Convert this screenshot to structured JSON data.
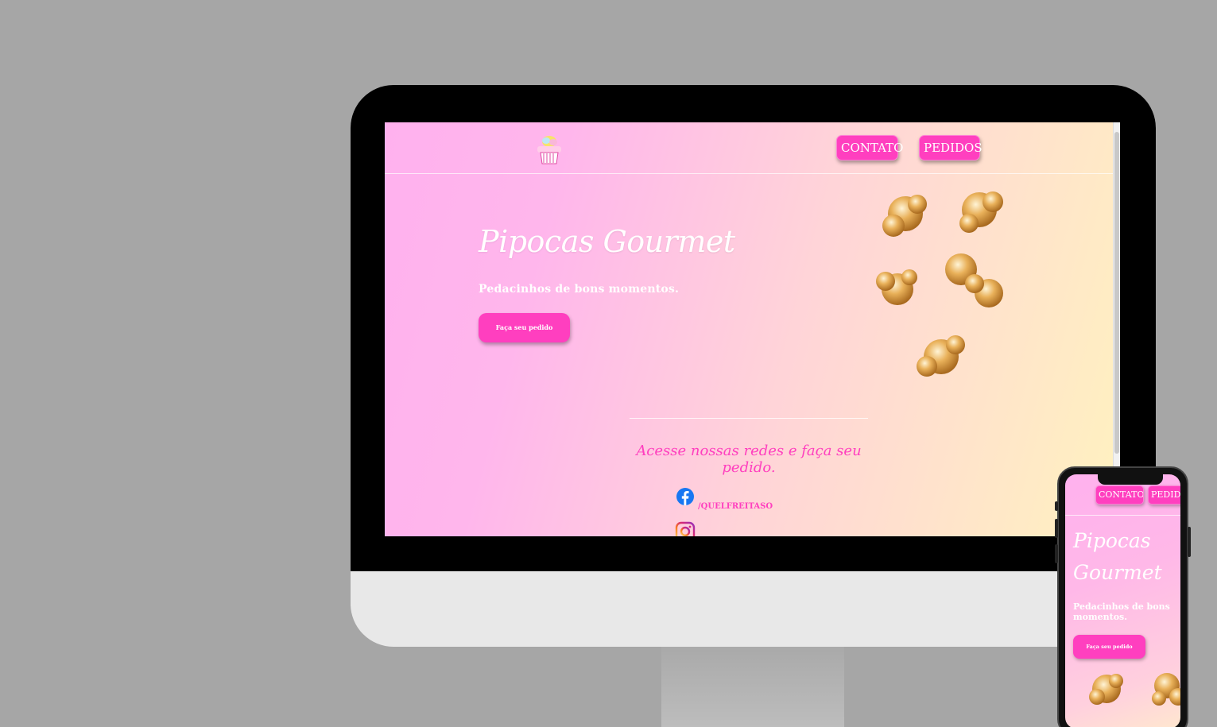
{
  "site": {
    "nav": {
      "contato": "CONTATO",
      "pedidos": "PEDIDOS"
    },
    "hero": {
      "title": "Pipocas Gourmet",
      "subtitle": "Pedacinhos de bons momentos.",
      "cta": "Faça seu pedido"
    },
    "social": {
      "heading": "Acesse nossas redes e faça seu pedido.",
      "facebook_handle": "/QUELFREITASO"
    }
  },
  "phone": {
    "nav": {
      "contato": "CONTATO",
      "pedidos": "PEDIDOS"
    },
    "title": "Pipocas Gourmet",
    "subtitle": "Pedacinhos de bons momentos.",
    "cta": "Faça seu pedido"
  },
  "colors": {
    "accent": "#ff3fbf",
    "backdrop": "#a6a6a6",
    "bezel": "#000000",
    "chin": "#e8e8e8"
  },
  "icons": [
    "cupcake-logo-icon",
    "facebook-icon",
    "instagram-icon",
    "popcorn-image"
  ]
}
